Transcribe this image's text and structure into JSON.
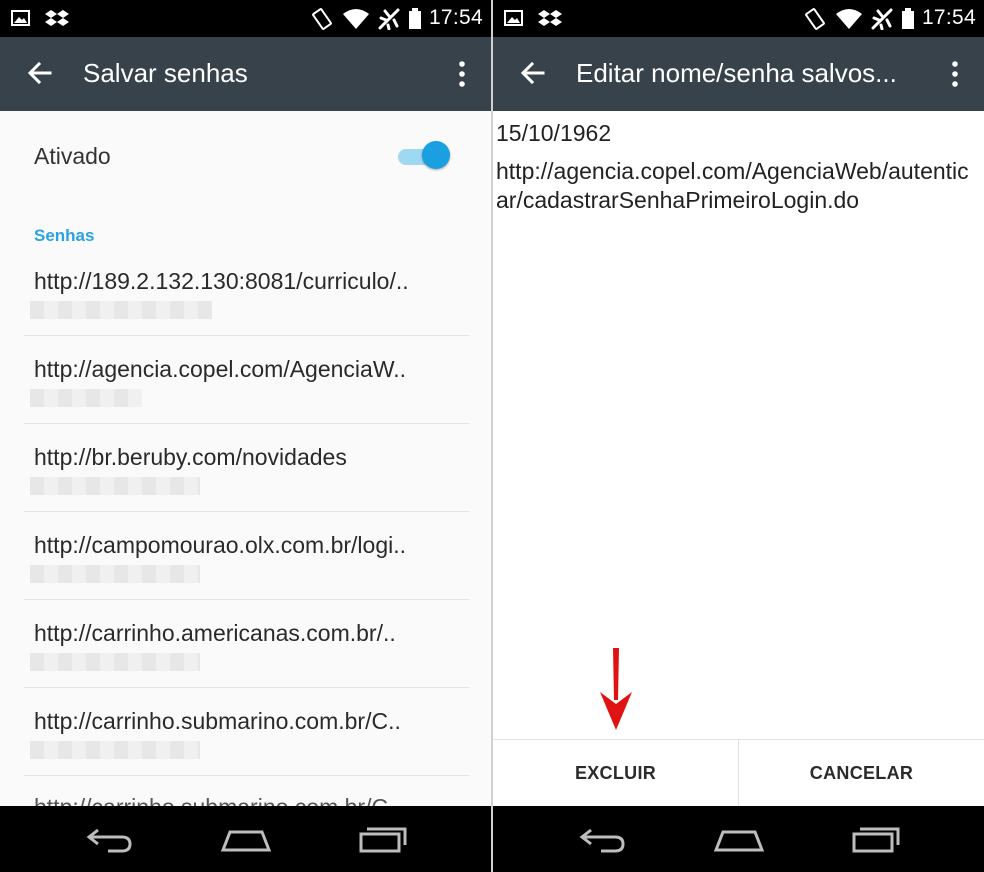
{
  "status_bar": {
    "time": "17:54",
    "icons": [
      "image-icon",
      "dropbox-icon",
      "rotate-icon",
      "wifi-icon",
      "airplane-icon",
      "battery-icon"
    ]
  },
  "left_screen": {
    "title": "Salvar senhas",
    "toggle": {
      "label": "Ativado",
      "state": "on",
      "accent": "#1a9fe0"
    },
    "section_header": "Senhas",
    "passwords": [
      {
        "url": "http://189.2.132.130:8081/curriculo/.."
      },
      {
        "url": "http://agencia.copel.com/AgenciaW.."
      },
      {
        "url": "http://br.beruby.com/novidades"
      },
      {
        "url": "http://campomourao.olx.com.br/logi.."
      },
      {
        "url": "http://carrinho.americanas.com.br/.."
      },
      {
        "url": "http://carrinho.submarino.com.br/C.."
      },
      {
        "url": "http://carrinho.submarino.com.br/C.."
      }
    ]
  },
  "right_screen": {
    "title": "Editar nome/senha salvos...",
    "date": "15/10/1962",
    "url": "http://agencia.copel.com/AgenciaWeb/autenticar/cadastrarSenhaPrimeiroLogin.do",
    "buttons": {
      "delete": "EXCLUIR",
      "cancel": "CANCELAR"
    },
    "annotation_arrow_color": "#e01212"
  },
  "colors": {
    "appbar": "#37424a",
    "section_header": "#2aa2e2"
  }
}
